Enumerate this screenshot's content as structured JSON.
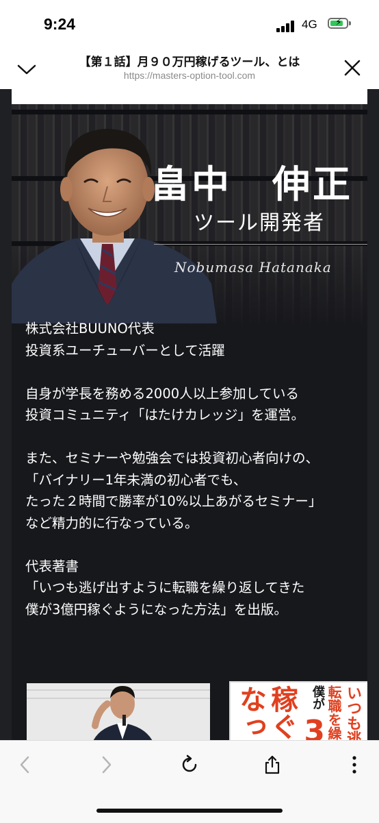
{
  "status_bar": {
    "time": "9:24",
    "network": "4G",
    "battery_level": 0.7,
    "icons": [
      "signal-icon",
      "battery-charging-icon"
    ]
  },
  "browser": {
    "page_title": "【第１話】月９０万円稼げるツール、とは",
    "url": "https://masters-option-tool.com",
    "icons": [
      "chevron-down-icon",
      "close-icon"
    ]
  },
  "profile": {
    "name": "畠中　伸正",
    "role": "ツール開発者",
    "romaji": "Nobumasa Hatanaka"
  },
  "bio": {
    "p1_line1": "株式会社BUUNO代表",
    "p1_line2": "投資系ユーチューバーとして活躍",
    "p2_line1": "自身が学長を務める2000人以上参加している",
    "p2_line2": "投資コミュニティ「はたけカレッジ」を運営。",
    "p3_line1": "また、セミナーや勉強会では投資初心者向けの、",
    "p3_line2": "「バイナリー1年未満の初心者でも、",
    "p3_line3": "たった２時間で勝率が10%以上あがるセミナー」",
    "p3_line4": "など精力的に行なっている。",
    "p4_line1": "代表著書",
    "p4_line2": "「いつも逃げ出すように転職を繰り返してきた",
    "p4_line3": "僕が3億円稼ぐようになった方法」を出版。"
  },
  "book_cover": {
    "text_right": "いつも逃",
    "text_mid": "転職を繰",
    "text_left": "僕が",
    "big_left": "稼ぐ",
    "big_right": "なった",
    "number": "3"
  },
  "toolbar": {
    "icons": [
      "back-icon",
      "forward-icon",
      "reload-icon",
      "share-icon",
      "more-icon"
    ]
  },
  "colors": {
    "accent_green": "#32c759",
    "hero_bg": "#17181c",
    "book_red": "#e0401f"
  }
}
